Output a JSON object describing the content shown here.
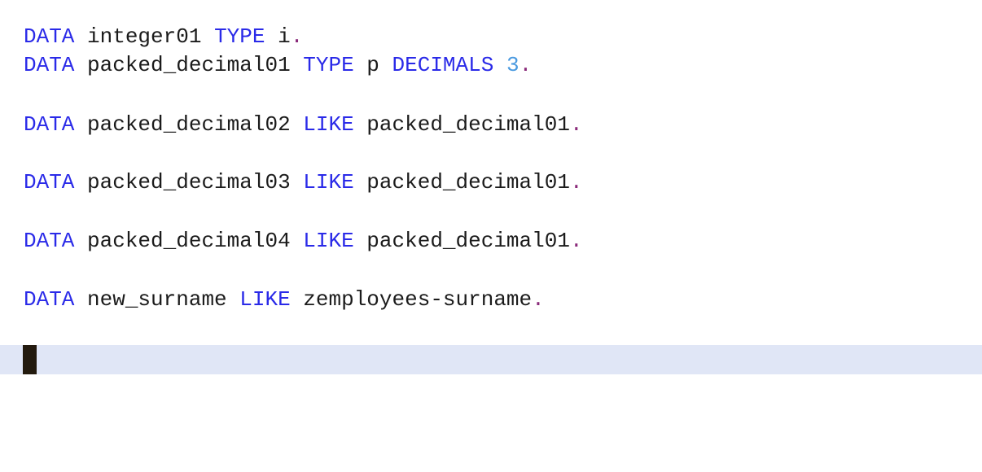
{
  "editor": {
    "lines": [
      {
        "tokens": [
          {
            "t": "kw",
            "v": "DATA"
          },
          {
            "t": "ident",
            "v": " integer01 "
          },
          {
            "t": "kw",
            "v": "TYPE"
          },
          {
            "t": "ident",
            "v": " i"
          },
          {
            "t": "punct",
            "v": "."
          }
        ]
      },
      {
        "tokens": [
          {
            "t": "kw",
            "v": "DATA"
          },
          {
            "t": "ident",
            "v": " packed_decimal01 "
          },
          {
            "t": "kw",
            "v": "TYPE"
          },
          {
            "t": "ident",
            "v": " p "
          },
          {
            "t": "kw",
            "v": "DECIMALS"
          },
          {
            "t": "ident",
            "v": " "
          },
          {
            "t": "num",
            "v": "3"
          },
          {
            "t": "punct",
            "v": "."
          }
        ]
      },
      {
        "tokens": [
          {
            "t": "kw",
            "v": "DATA"
          },
          {
            "t": "ident",
            "v": " packed_decimal02 "
          },
          {
            "t": "kw",
            "v": "LIKE"
          },
          {
            "t": "ident",
            "v": " packed_decimal01"
          },
          {
            "t": "punct",
            "v": "."
          }
        ]
      },
      {
        "tokens": [
          {
            "t": "kw",
            "v": "DATA"
          },
          {
            "t": "ident",
            "v": " packed_decimal03 "
          },
          {
            "t": "kw",
            "v": "LIKE"
          },
          {
            "t": "ident",
            "v": " packed_decimal01"
          },
          {
            "t": "punct",
            "v": "."
          }
        ]
      },
      {
        "tokens": [
          {
            "t": "kw",
            "v": "DATA"
          },
          {
            "t": "ident",
            "v": " packed_decimal04 "
          },
          {
            "t": "kw",
            "v": "LIKE"
          },
          {
            "t": "ident",
            "v": " packed_decimal01"
          },
          {
            "t": "punct",
            "v": "."
          }
        ]
      },
      {
        "tokens": [
          {
            "t": "kw",
            "v": "DATA"
          },
          {
            "t": "ident",
            "v": " new_surname "
          },
          {
            "t": "kw",
            "v": "LIKE"
          },
          {
            "t": "ident",
            "v": " zemployees-surname"
          },
          {
            "t": "punct",
            "v": "."
          }
        ]
      }
    ],
    "colors": {
      "keyword": "#2a2ae8",
      "number": "#4a9ae0",
      "punctuation": "#8a2a7a",
      "identifier": "#1b1b1b",
      "current_line_highlight": "#e0e6f6",
      "caret": "#231a0e"
    }
  }
}
